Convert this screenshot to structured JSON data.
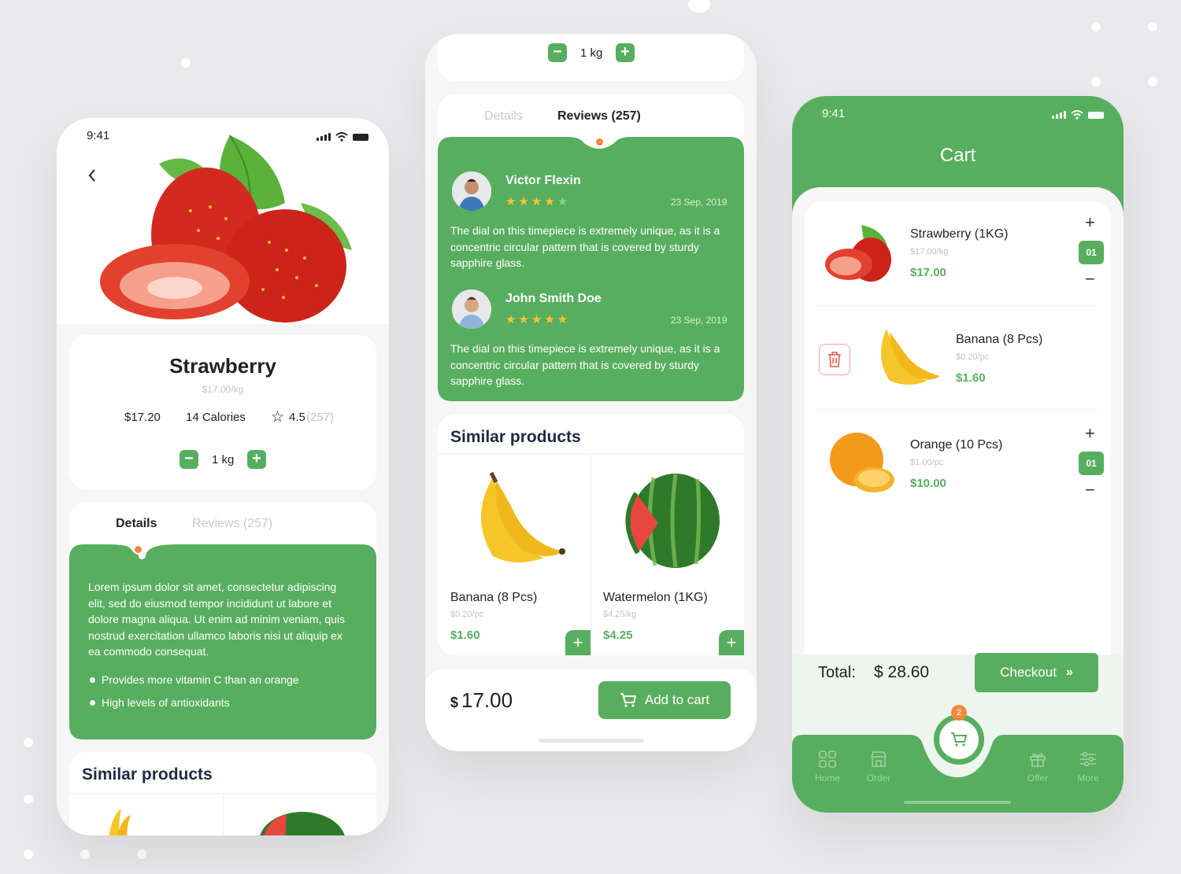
{
  "colors": {
    "accent": "#58ae5f",
    "price": "#58ae5f",
    "star": "#ffc431",
    "dot": "#f08a3c",
    "background": "#e9e9eb"
  },
  "screen1": {
    "time": "9:41",
    "back_icon": "chevron-left-icon",
    "product": {
      "name": "Strawberry",
      "unit_price": "$17.00/kg",
      "price": "$17.20",
      "calories": "14 Calories",
      "rating": "4.5",
      "review_count": "(257)"
    },
    "quantity": "1 kg",
    "tabs": {
      "details": "Details",
      "reviews": "Reviews (257)"
    },
    "description": "Lorem ipsum dolor sit amet, consectetur adipiscing elit, sed do eiusmod tempor incididunt ut labore et dolore magna aliqua. Ut enim ad minim veniam, quis nostrud exercitation ullamco laboris nisi ut aliquip ex ea commodo consequat.",
    "bullets": [
      "Provides more vitamin C than an orange",
      "High levels of antioxidants"
    ],
    "similar_title": "Similar products"
  },
  "screen2": {
    "quantity": "1 kg",
    "tabs": {
      "details": "Details",
      "reviews": "Reviews (257)"
    },
    "reviews": [
      {
        "name": "Victor Flexin",
        "date": "23 Sep, 2019",
        "stars": 4,
        "text": "The dial on this timepiece is extremely unique, as it is a concentric circular pattern that is covered by sturdy sapphire glass."
      },
      {
        "name": "John Smith Doe",
        "date": "23 Sep, 2019",
        "stars": 5,
        "text": "The dial on this timepiece is extremely unique, as it is a concentric circular pattern that is covered by sturdy sapphire glass."
      }
    ],
    "similar_title": "Similar products",
    "similar": [
      {
        "name": "Banana (8 Pcs)",
        "unit": "$0.20/pc",
        "price": "$1.60"
      },
      {
        "name": "Watermelon (1KG)",
        "unit": "$4.25/kg",
        "price": "$4.25"
      }
    ],
    "total_currency": "$",
    "total_amount": "17.00",
    "add_to_cart": "Add to cart"
  },
  "screen3": {
    "time": "9:41",
    "title": "Cart",
    "items": [
      {
        "name": "Strawberry (1KG)",
        "unit": "$17.00/kg",
        "price": "$17.00",
        "count": "01"
      },
      {
        "name": "Banana (8 Pcs)",
        "unit": "$0.20/pc",
        "price": "$1.60"
      },
      {
        "name": "Orange (10 Pcs)",
        "unit": "$1.00/pc",
        "price": "$10.00",
        "count": "01"
      }
    ],
    "total_label": "Total:",
    "total_value": "$ 28.60",
    "checkout": "Checkout",
    "cart_badge": "2",
    "nav": {
      "home": "Home",
      "order": "Order",
      "offer": "Offer",
      "more": "More"
    }
  }
}
